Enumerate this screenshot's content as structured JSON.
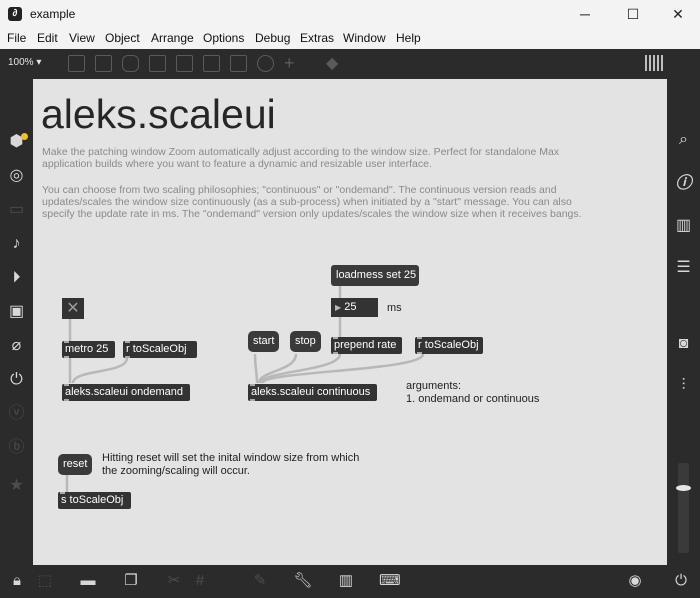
{
  "window": {
    "title": "example",
    "minimize": "─",
    "maximize": "☐",
    "close": "✕"
  },
  "menu": [
    "File",
    "Edit",
    "View",
    "Object",
    "Arrange",
    "Options",
    "Debug",
    "Extras",
    "Window",
    "Help"
  ],
  "toolbar": {
    "zoom": "100% ▾"
  },
  "patch": {
    "heading": "aleks.scaleui",
    "paragraph1": "Make the patching window Zoom automatically adjust according to the window size. Perfect for standalone Max application builds where you want to feature a dynamic and resizable user interface.",
    "paragraph2": "You can choose from two scaling philosophies; \"continuous\" or \"ondemand\". The continuous version reads and updates/scales the window size continuously (as a sub-process) when initiated by a \"start\" message. You can also specify the update rate in ms. The \"ondemand\" version only updates/scales the window size when it receives bangs.",
    "objects": {
      "metro": "metro 25",
      "r_scale_left": "r toScaleObj",
      "ondemand": "aleks.scaleui ondemand",
      "loadmess": "loadmess set 25",
      "number": "25",
      "ms": "ms",
      "start": "start",
      "stop": "stop",
      "prepend": "prepend rate",
      "r_scale_right": "r toScaleObj",
      "continuous": "aleks.scaleui continuous",
      "args_title": "arguments:",
      "args_line": "1. ondemand or continuous",
      "reset": "reset",
      "reset_comment": "Hitting reset will set the inital window size from which the zooming/scaling will occur.",
      "s_scale": "s toScaleObj"
    }
  }
}
